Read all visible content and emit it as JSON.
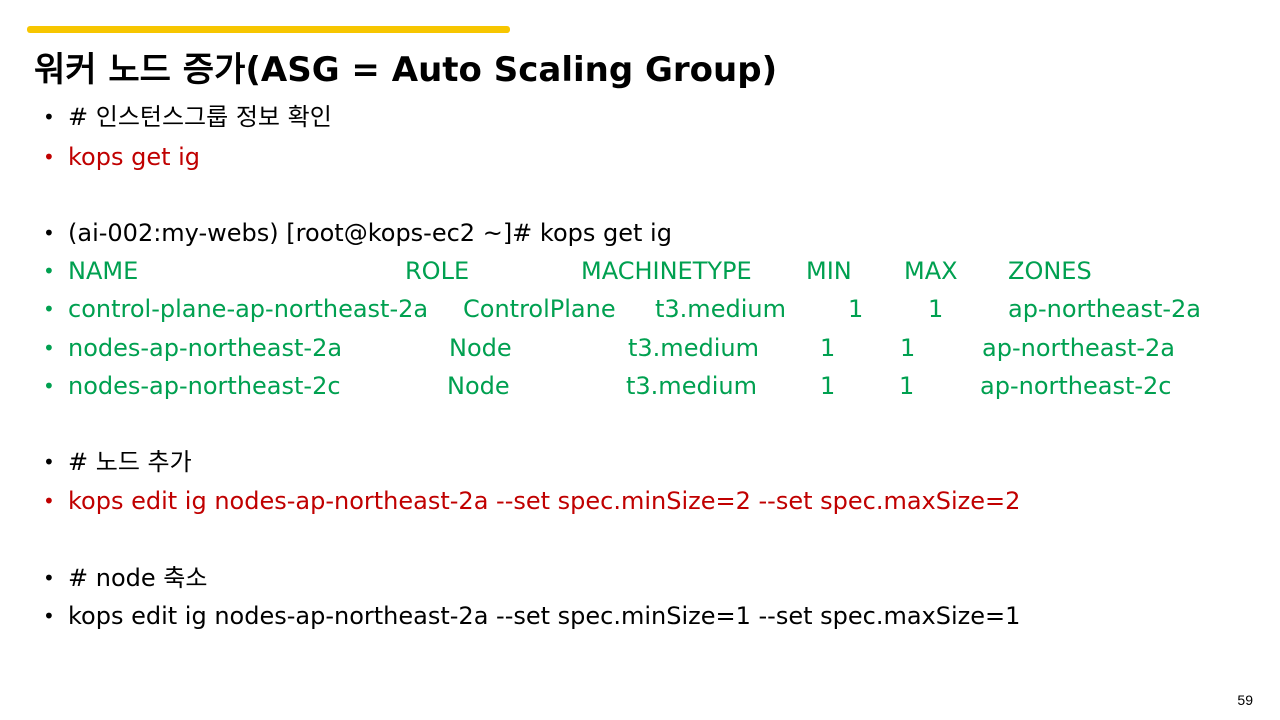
{
  "title": "워커 노드 증가(ASG = Auto Scaling Group)",
  "lines": [
    {
      "text": "# 인스턴스그룹 정보 확인"
    },
    {
      "text": "kops get ig"
    },
    {
      "text": "(ai-002:my-webs) [root@kops-ec2 ~]# kops get ig"
    },
    {
      "text": "# 노드 추가"
    },
    {
      "text": "kops edit ig nodes-ap-northeast-2a --set spec.minSize=2 --set spec.maxSize=2"
    },
    {
      "text": "# node 축소"
    },
    {
      "text": "kops edit ig nodes-ap-northeast-2a --set spec.minSize=1 --set spec.maxSize=1"
    }
  ],
  "table": {
    "headers": [
      "NAME",
      "ROLE",
      "MACHINETYPE",
      "MIN",
      "MAX",
      "ZONES"
    ],
    "rows": [
      [
        "control-plane-ap-northeast-2a",
        "ControlPlane",
        "t3.medium",
        "1",
        "1",
        "ap-northeast-2a"
      ],
      [
        "nodes-ap-northeast-2a",
        "Node",
        "t3.medium",
        "1",
        "1",
        "ap-northeast-2a"
      ],
      [
        "nodes-ap-northeast-2c",
        "Node",
        "t3.medium",
        "1",
        "1",
        "ap-northeast-2c"
      ]
    ]
  },
  "page_number": "59",
  "colors": {
    "accent": "#F7C600",
    "command_red": "#C00000",
    "output_green": "#00A050",
    "text": "#000000"
  }
}
